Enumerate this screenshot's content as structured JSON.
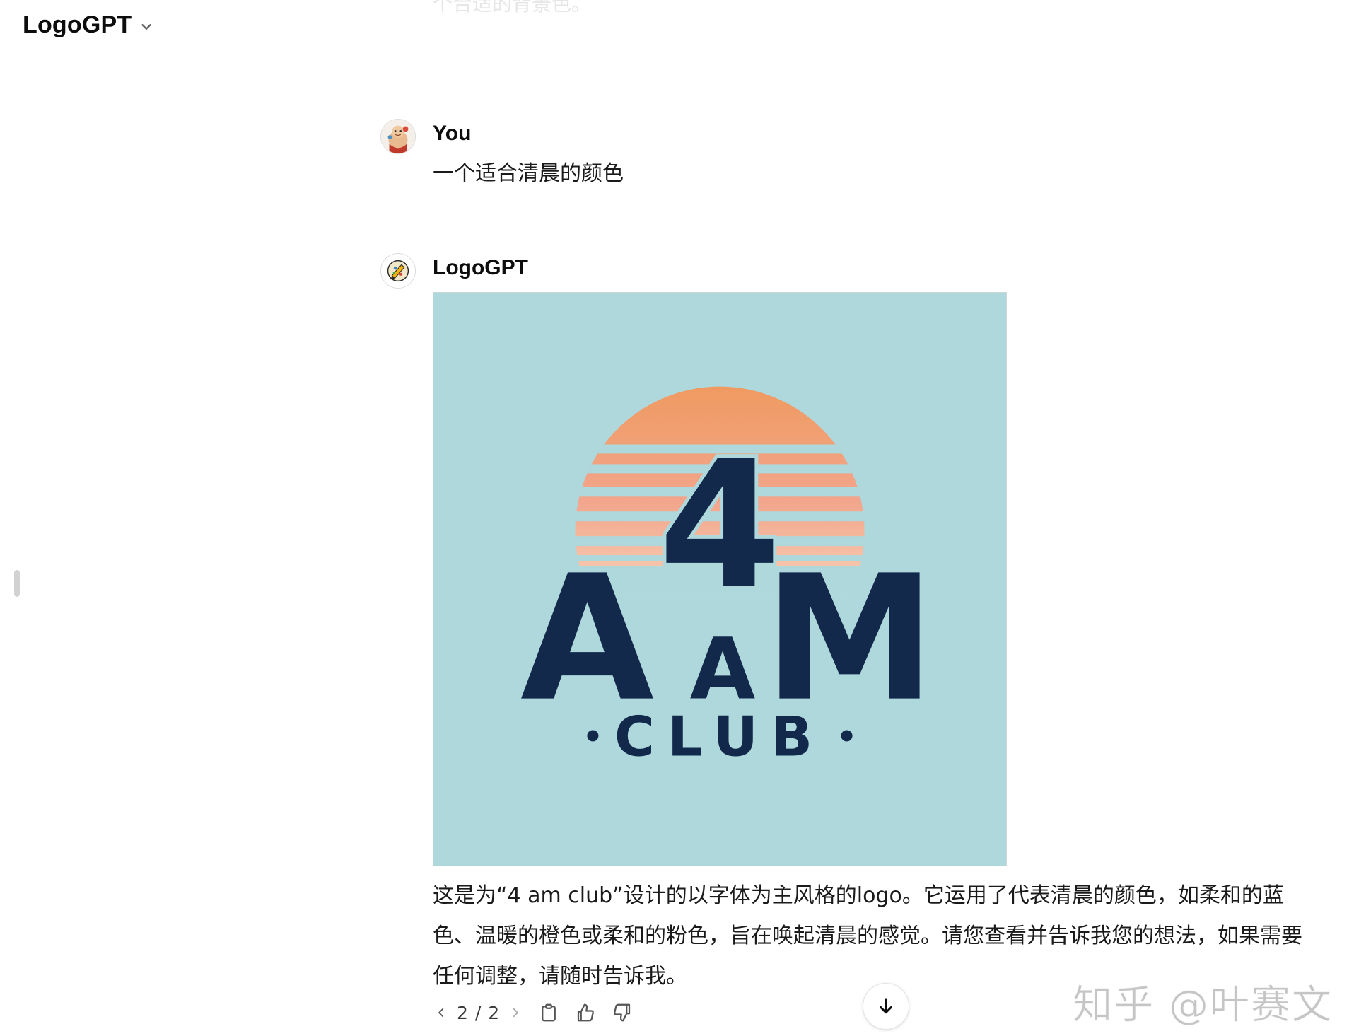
{
  "header": {
    "model_name": "LogoGPT",
    "chevron_icon": "chevron-down-icon"
  },
  "faded_previous_text": "个合适的背景色。",
  "messages": [
    {
      "author": "You",
      "avatar_icon": "user-avatar-icon",
      "text": "一个适合清晨的颜色"
    },
    {
      "author": "LogoGPT",
      "avatar_icon": "logogpt-avatar-icon",
      "image": {
        "background_color": "#aed8dc",
        "logo_text": {
          "big_digit": "4",
          "big_a": "A",
          "small_a": "A",
          "big_m": "M",
          "club": "CLUB"
        },
        "colors": {
          "navy": "#13294b",
          "sun_top": "#f09a60",
          "sun_mid": "#f2a889",
          "sun_bottom": "#f7c5a8"
        }
      },
      "text": "这是为“4 am club”设计的以字体为主风格的logo。它运用了代表清晨的颜色，如柔和的蓝色、温暖的橙色或柔和的粉色，旨在唤起清晨的感觉。请您查看并告诉我您的想法，如果需要任何调整，请随时告诉我。",
      "pager": "2 / 2",
      "actions": [
        "copy-icon",
        "thumbs-up-icon",
        "thumbs-down-icon"
      ]
    }
  ],
  "scroll_down_icon": "arrow-down-icon",
  "watermark": "知乎 @叶赛文"
}
